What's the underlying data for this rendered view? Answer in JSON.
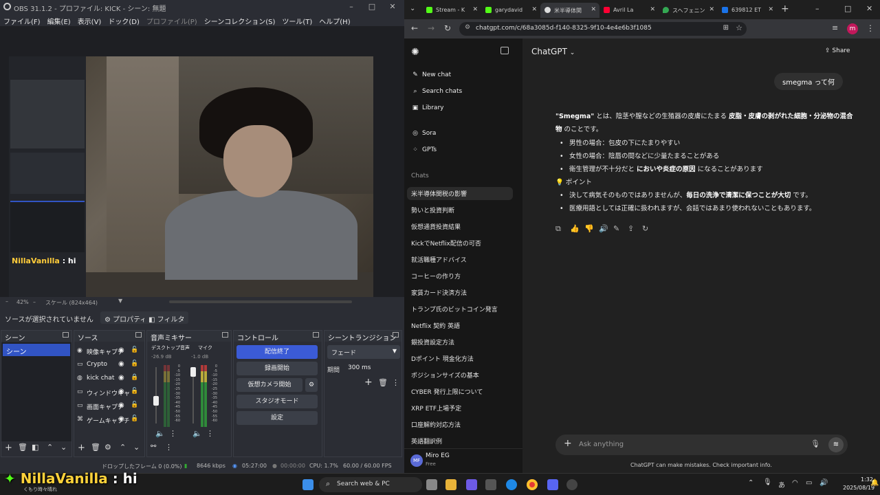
{
  "obs": {
    "title": "OBS 31.1.2 - プロファイル: KICK - シーン: 無題",
    "menu": [
      "ファイル(F)",
      "編集(E)",
      "表示(V)",
      "ドック(D)",
      "プロファイル(P)",
      "シーンコレクション(S)",
      "ツール(T)",
      "ヘルプ(H)"
    ],
    "preview_chat_name": "NillaVanilla",
    "preview_chat_msg": ": hi",
    "zoom": "42%",
    "scale": "スケール (824x464)",
    "no_source": "ソースが選択されていません",
    "properties": "プロパティ",
    "filters": "フィルタ",
    "docks": {
      "scenes": "シーン",
      "sources": "ソース",
      "mixer": "音声ミキサー",
      "controls": "コントロール",
      "transitions": "シーントランジション"
    },
    "scene_items": [
      "シーン"
    ],
    "sources": [
      "映像キャプチ",
      "Crypto",
      "kick chat",
      "ウィンドウキャ",
      "画面キャプチ",
      "ゲームキャプチ"
    ],
    "mixer": {
      "desktop_label": "デスクトップ音声",
      "desktop_db": "-26.9 dB",
      "mic_label": "マイク",
      "mic_db": "-1.0 dB",
      "scale": [
        "0",
        "-5",
        "-10",
        "-15",
        "-20",
        "-25",
        "-30",
        "-35",
        "-40",
        "-45",
        "-50",
        "-55",
        "-60"
      ]
    },
    "controls": [
      "配信終了",
      "録画開始",
      "仮想カメラ開始",
      "スタジオモード",
      "設定"
    ],
    "transition": "フェード",
    "duration_label": "期間",
    "duration": "300 ms",
    "status": {
      "dropped": "ドロップしたフレーム 0 (0.0%)",
      "bitrate": "8646 kbps",
      "stream_time": "05:27:00",
      "rec_time": "00:00:00",
      "cpu": "CPU: 1.7%",
      "fps": "60.00 / 60.00 FPS"
    }
  },
  "browser": {
    "tabs": [
      {
        "label": "Stream - K",
        "color": "#53fc18"
      },
      {
        "label": "garydavid",
        "color": "#53fc18"
      },
      {
        "label": "米半導体関",
        "color": "#dddddd"
      },
      {
        "label": "Avril La",
        "color": "#ff0033"
      },
      {
        "label": "スヘフェニン",
        "color": "#34a853"
      },
      {
        "label": "639812 ET",
        "color": "#1a73e8"
      }
    ],
    "url": "chatgpt.com/c/68a3085d-f140-8325-9f10-4e4e6b3f1085",
    "profile": "m"
  },
  "chatgpt": {
    "model": "ChatGPT",
    "share": "Share",
    "nav": [
      "New chat",
      "Search chats",
      "Library",
      "Sora",
      "GPTs"
    ],
    "chats_heading": "Chats",
    "chats": [
      "米半導体関税の影響",
      "勢いと投資判断",
      "仮想通貨投資結果",
      "KickでNetflix配信の可否",
      "就活職種アドバイス",
      "コーヒーの作り方",
      "家賃カード決済方法",
      "トランプ氏のビットコイン発言",
      "Netflix 契約 英語",
      "銀投資設定方法",
      "Dポイント 現金化方法",
      "ポジションサイズの基本",
      "CYBER 発行上限について",
      "XRP ETF上場予定",
      "口座解約対応方法",
      "英語翻訳例"
    ],
    "user_name": "Miro EG",
    "user_plan": "Free",
    "user_initials": "MF",
    "user_msg": "smegma って何",
    "answer": {
      "p1_a": "\"Smegma\"",
      "p1_b": " とは、陰茎や膣などの生殖器の皮膚にたまる ",
      "p1_c": "皮脂・皮膚の剥がれた細胞・分泌物の混合物",
      "p1_d": " のことです。",
      "li1": "男性の場合：包皮の下にたまりやすい",
      "li2": "女性の場合：陰唇の間などに少量たまることがある",
      "li3_a": "衛生管理が不十分だと ",
      "li3_b": "においや炎症の原因",
      "li3_c": " になることがあります",
      "point": "ポイント",
      "li4_a": "決して病気そのものではありませんが、",
      "li4_b": "毎日の洗浄で清潔に保つことが大切",
      "li4_c": " です。",
      "li5": "医療用語としては正確に扱われますが、会話ではあまり使われないこともあります。"
    },
    "placeholder": "Ask anything",
    "disclaimer": "ChatGPT can make mistakes. Check important info."
  },
  "taskbar": {
    "search": "Search web & PC",
    "time": "1:32",
    "date": "2025/08/19",
    "weather": "くもり時々晴れ"
  },
  "overlay": {
    "name": "NillaVanilla",
    "msg": ": hi"
  }
}
